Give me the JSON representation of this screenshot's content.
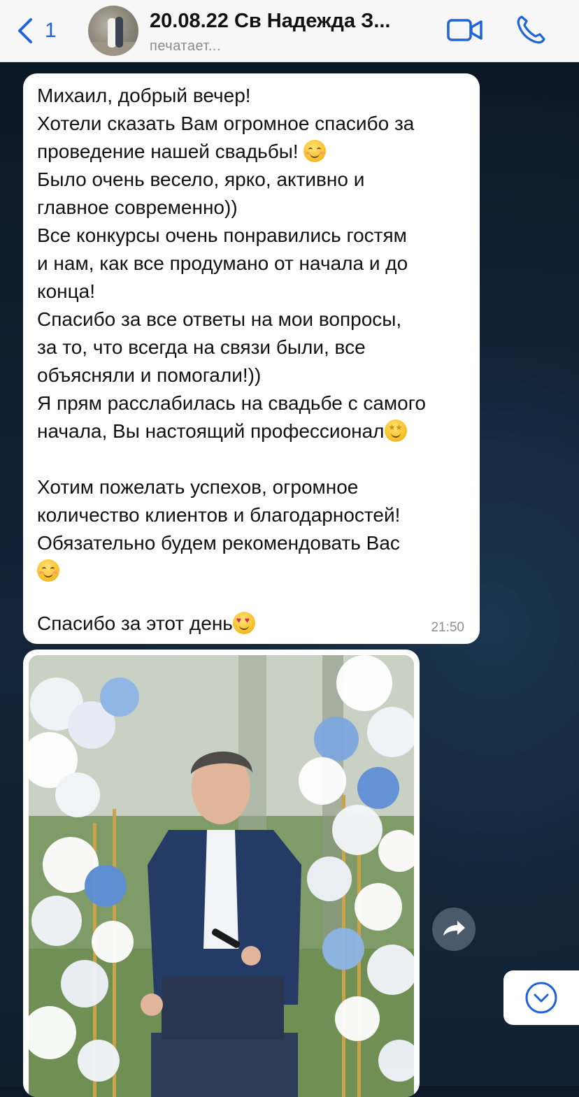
{
  "header": {
    "back_count": "1",
    "title": "20.08.22 Св Надежда З...",
    "status": "печатает..."
  },
  "message": {
    "lines": [
      "Михаил, добрый вечер!",
      "Хотели сказать Вам огромное спасибо за",
      "проведение нашей свадьбы! ",
      "Было очень весело, ярко, активно и",
      "главное современно))",
      "Все конкурсы очень понравились гостям",
      "и нам, как все продумано от начала и до",
      "конца!",
      "Спасибо за все ответы на мои вопросы,",
      "за то, что всегда на связи были, все",
      "объясняли и помогали!))",
      "Я прям расслабилась на свадьбе с самого",
      "начала, Вы настоящий профессионал",
      "Хотим пожелать успехов, огромное",
      "количество клиентов и благодарностей!",
      "Обязательно будем рекомендовать Вас",
      "Спасибо за этот день"
    ],
    "time": "21:50"
  },
  "icons": {
    "back": "chevron-left-icon",
    "video": "video-camera-icon",
    "call": "phone-icon",
    "forward": "forward-arrow-icon",
    "scroll": "chevron-down-circle-icon"
  },
  "colors": {
    "accent": "#1f63d8",
    "bubble": "#ffffff",
    "chat_bg": "#0e1a2a"
  }
}
